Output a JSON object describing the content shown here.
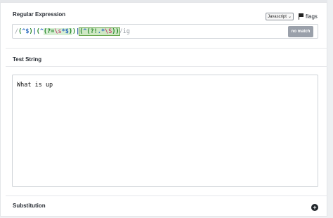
{
  "regex": {
    "title": "Regular Expression",
    "flavor": "Javascript",
    "flags_label": "flags",
    "delimiter_open": "/",
    "pattern_parts": {
      "p1_open": "(",
      "p1_anchor": "^$",
      "p1_close": ")",
      "alt1": "|",
      "p2_open": "(",
      "p2_anchor": "^",
      "p2_la": "(?=",
      "p2_esc": "\\s",
      "p2_rest": "*$",
      "p2_la_close": ")",
      "p2_close": ")",
      "alt2": "|",
      "p3_open": "(",
      "p3_anchor": "^",
      "p3_la": "(?!",
      "p3_mid": ".*",
      "p3_esc": "\\S",
      "p3_la_close": ")",
      "p3_close": ")"
    },
    "delimiter_close": "/",
    "flags": "ig",
    "status": "no match"
  },
  "test_string": {
    "title": "Test String",
    "value": "What is up"
  },
  "substitution": {
    "title": "Substitution"
  },
  "icons": {
    "flags": "flag-icon",
    "flavor_dropdown": "chevron-down-icon",
    "add": "plus-circle-icon"
  }
}
